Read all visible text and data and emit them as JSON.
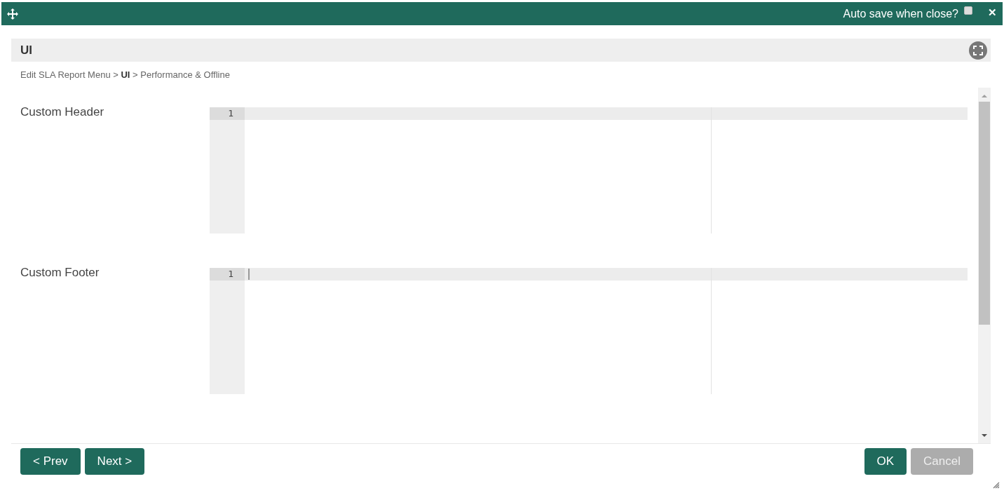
{
  "window": {
    "auto_save_label": "Auto save when close?",
    "auto_save_checked": false,
    "close": "✕"
  },
  "panel": {
    "title": "UI",
    "breadcrumb": "Edit SLA Report Menu > **UI** > Performance & Offline"
  },
  "fields": [
    {
      "label": "Custom Header",
      "line_number": "1",
      "focused": false
    },
    {
      "label": "Custom Footer",
      "line_number": "1",
      "focused": true
    }
  ],
  "nav_buttons": [
    {
      "label": "< Prev",
      "disabled": false
    },
    {
      "label": "Next >",
      "disabled": false
    }
  ],
  "action_buttons": [
    {
      "label": "OK",
      "disabled": false
    },
    {
      "label": "Cancel",
      "disabled": true
    }
  ]
}
